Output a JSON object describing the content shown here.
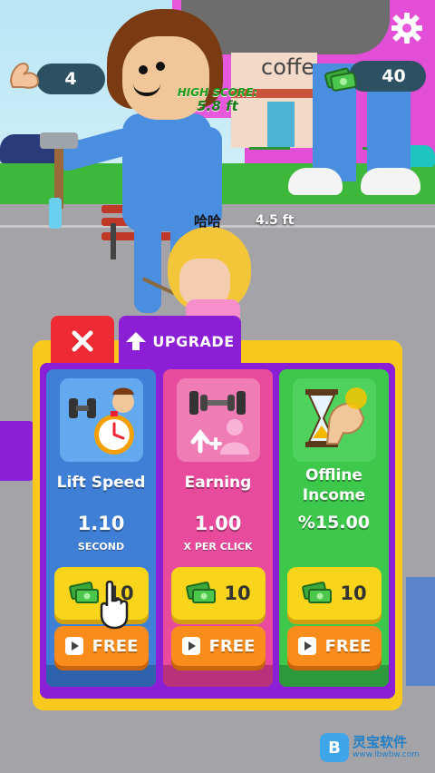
{
  "hud": {
    "strength": "4",
    "cash": "40",
    "high_score_label": "HIGH SCORE:",
    "high_score_value": "5.8 ft",
    "float_label": "哈哈",
    "float_distance": "4.5 ft",
    "shop_sign": "coffe"
  },
  "panel": {
    "tab_upgrade": "UPGRADE",
    "cards": [
      {
        "title": "Lift Speed",
        "value": "1.10",
        "unit": "SECOND",
        "price": "10",
        "free": "FREE",
        "color": "#3f80d6"
      },
      {
        "title": "Earning",
        "value": "1.00",
        "unit": "X PER CLICK",
        "price": "10",
        "free": "FREE",
        "color": "#e84b9c"
      },
      {
        "title": "Offline Income",
        "value": "%15.00",
        "unit": "",
        "price": "10",
        "free": "FREE",
        "color": "#3dc74b"
      }
    ]
  },
  "watermark": {
    "name": "灵宝软件",
    "url": "www.lbwbw.com"
  },
  "icons": [
    "gear-icon",
    "flex-arm-icon",
    "cash-icon",
    "close-icon",
    "arrow-up-icon",
    "dumbbell-icon",
    "hourglass-icon",
    "play-icon",
    "hand-cursor-icon"
  ],
  "colors": {
    "accent_purple": "#8a1fd6",
    "panel_yellow": "#f8c91c",
    "close_red": "#ee2a34"
  }
}
